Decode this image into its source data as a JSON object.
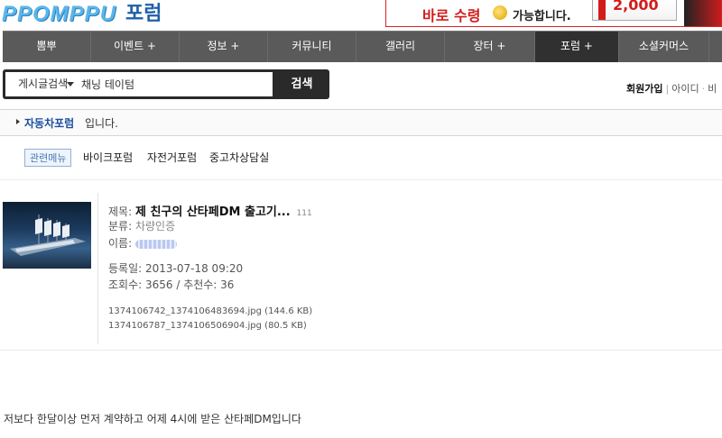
{
  "header": {
    "logo_text": "PPOMPPU",
    "page_title": "포럼",
    "ad": {
      "left": "바로 수령",
      "right": "가능합니다.",
      "amount": "2,000"
    }
  },
  "nav": [
    {
      "label": "뽐뿌"
    },
    {
      "label": "이벤트 +"
    },
    {
      "label": "정보 +"
    },
    {
      "label": "커뮤니티"
    },
    {
      "label": "갤러리"
    },
    {
      "label": "장터 +"
    },
    {
      "label": "포럼 +",
      "active": true
    },
    {
      "label": "소셜커머스"
    }
  ],
  "search": {
    "select_value": "게시글검색",
    "input_value": "채닝 테이텀",
    "button_label": "검색"
  },
  "member": {
    "join": "회원가입",
    "login": "아이디",
    "more": "비"
  },
  "forum": {
    "name": "자동차포럼",
    "suffix": "입니다.",
    "related_label": "관련메뉴",
    "related_links": [
      "바이크포럼",
      "자전거포럼",
      "중고차상담실"
    ]
  },
  "post": {
    "title_label": "제목:",
    "title": "제 친구의 산타페DM 출고기...",
    "comment_count": "111",
    "category_label": "분류:",
    "category": "차량인증",
    "author_label": "이름:",
    "date_label": "등록일:",
    "date": "2013-07-18 09:20",
    "views_line": "조회수: 3656 / 추천수: 36",
    "attachments": [
      "1374106742_1374106483694.jpg (144.6 KB)",
      "1374106787_1374106506904.jpg (80.5 KB)"
    ],
    "body": "저보다 한달이상 먼저 계약하고 어제 4시에 받은 산타페DM입니다"
  },
  "colors": {
    "nav_bg": "#5a5a5a",
    "nav_active": "#303030",
    "forum_name": "#1c4ea1",
    "logo": "#5ab6ea"
  }
}
